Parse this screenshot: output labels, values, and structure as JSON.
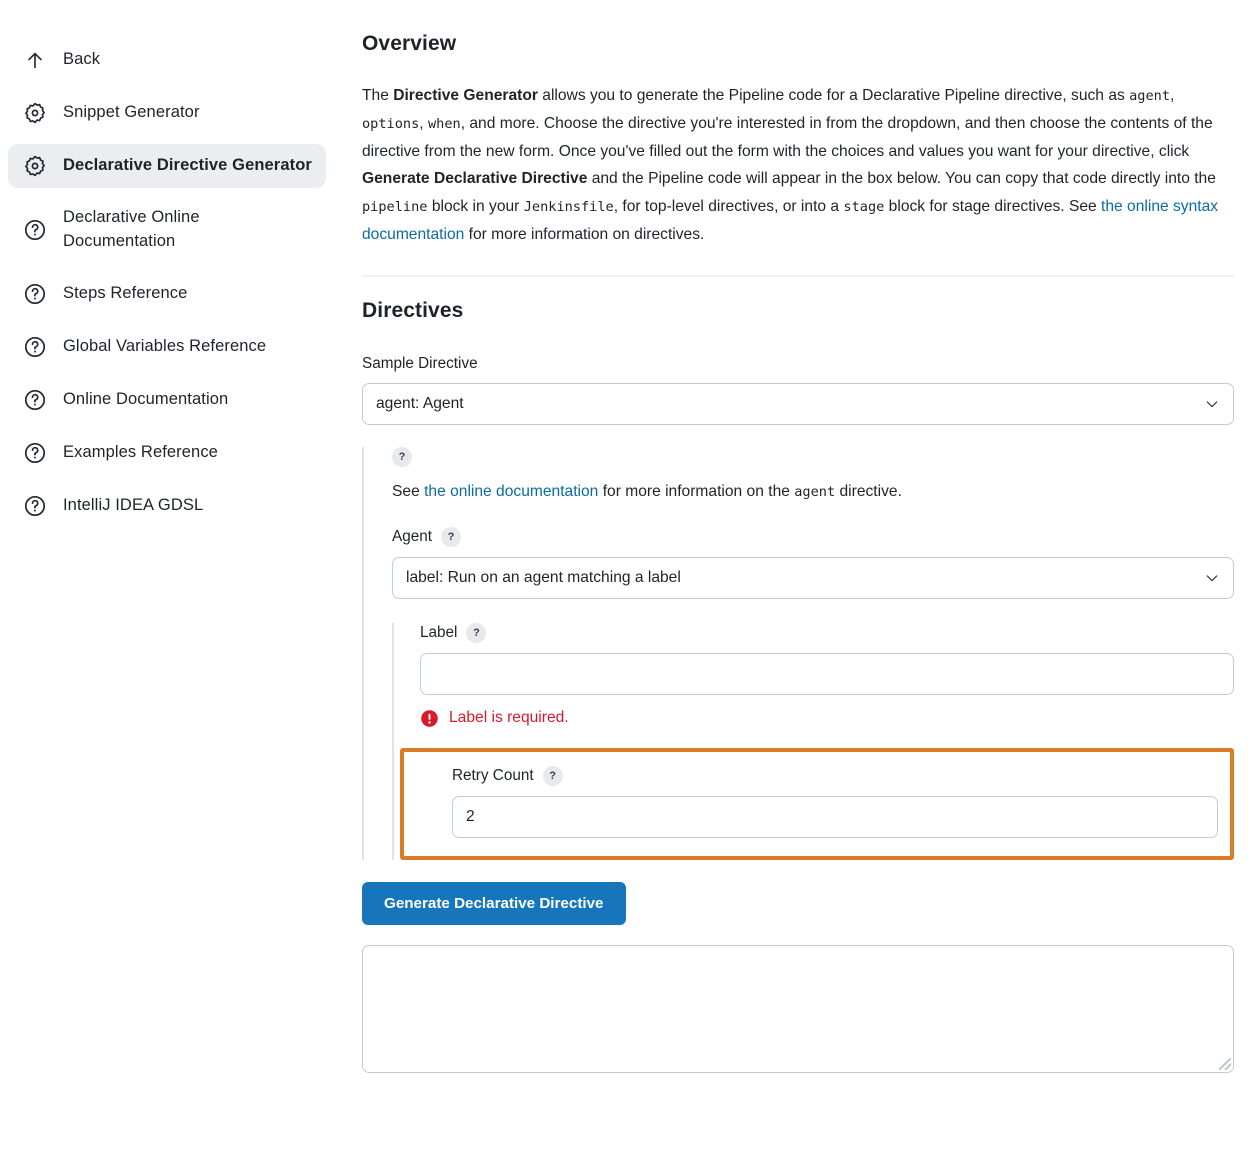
{
  "sidebar": {
    "items": [
      {
        "label": "Back",
        "icon": "arrow-up-icon",
        "active": false
      },
      {
        "label": "Snippet Generator",
        "icon": "gear-icon",
        "active": false
      },
      {
        "label": "Declarative Directive Generator",
        "icon": "gear-icon",
        "active": true
      },
      {
        "label": "Declarative Online Documentation",
        "icon": "question-circle-icon",
        "active": false
      },
      {
        "label": "Steps Reference",
        "icon": "question-circle-icon",
        "active": false
      },
      {
        "label": "Global Variables Reference",
        "icon": "question-circle-icon",
        "active": false
      },
      {
        "label": "Online Documentation",
        "icon": "question-circle-icon",
        "active": false
      },
      {
        "label": "Examples Reference",
        "icon": "question-circle-icon",
        "active": false
      },
      {
        "label": "IntelliJ IDEA GDSL",
        "icon": "question-circle-icon",
        "active": false
      }
    ]
  },
  "overview": {
    "title": "Overview",
    "p1": "The ",
    "strong1": "Directive Generator",
    "p2": " allows you to generate the Pipeline code for a Declarative Pipeline directive, such as ",
    "code1": "agent",
    "p3": ", ",
    "code2": "options",
    "p4": ", ",
    "code3": "when",
    "p5": ", and more. Choose the directive you're interested in from the dropdown, and then choose the contents of the directive from the new form. Once you've filled out the form with the choices and values you want for your directive, click ",
    "strong2": "Generate Declarative Directive",
    "p6": " and the Pipeline code will appear in the box below. You can copy that code directly into the ",
    "code4": "pipeline",
    "p7": " block in your ",
    "code5": "Jenkinsfile",
    "p8": ", for top-level directives, or into a ",
    "code6": "stage",
    "p9": " block for stage directives. See ",
    "link_text": "the online syntax documentation",
    "p10": " for more information on directives."
  },
  "directives": {
    "title": "Directives",
    "sample_directive_label": "Sample Directive",
    "sample_directive_value": "agent: Agent",
    "help_icon_label": "?",
    "doc_line_pre": "See ",
    "doc_link": "the online documentation",
    "doc_line_mid": " for more information on the ",
    "doc_line_code": "agent",
    "doc_line_post": " directive.",
    "agent_label": "Agent",
    "agent_value": "label: Run on an agent matching a label",
    "label_label": "Label",
    "label_value": "",
    "label_placeholder": "",
    "error_text": "Label is required.",
    "retry_count_label": "Retry Count",
    "retry_count_value": "2",
    "generate_button": "Generate Declarative Directive",
    "output_value": "",
    "output_placeholder": ""
  },
  "colors": {
    "accent_blue": "#1776bb",
    "link_blue": "#0b6aa2",
    "error_red": "#d6192b",
    "highlight_orange": "#da7b26",
    "active_nav_bg": "#ebedf0",
    "border_gray": "#c3ccd4"
  }
}
